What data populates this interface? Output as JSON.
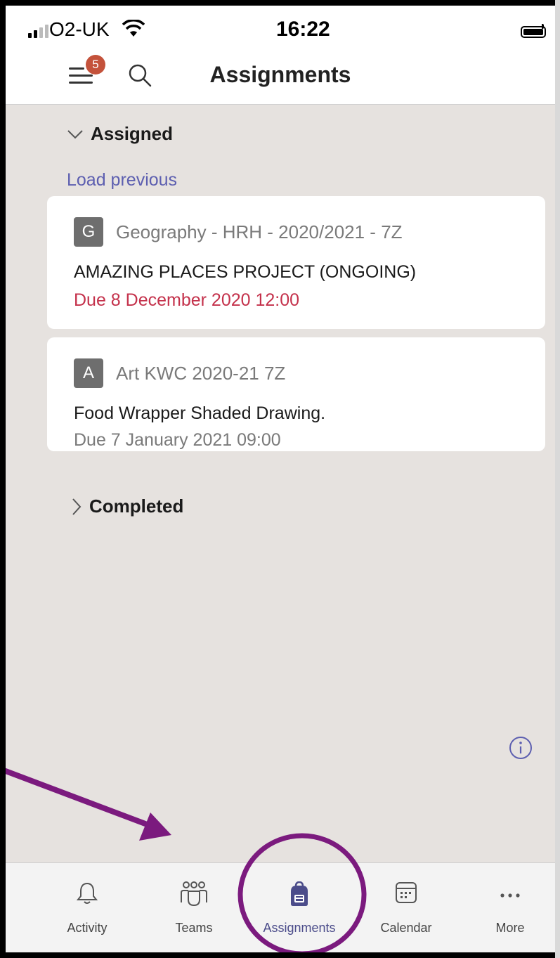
{
  "status_bar": {
    "carrier": "O2-UK",
    "time": "16:22"
  },
  "header": {
    "title": "Assignments",
    "notification_count": "5"
  },
  "assigned_section": {
    "label": "Assigned",
    "load_previous": "Load previous"
  },
  "assignments": [
    {
      "letter": "G",
      "course": "Geography - HRH - 2020/2021 - 7Z",
      "title": "AMAZING PLACES PROJECT (ONGOING)",
      "due": "Due 8 December 2020 12:00",
      "due_color": "#c4314b"
    },
    {
      "letter": "A",
      "course": "Art KWC 2020-21 7Z",
      "title": "Food Wrapper Shaded Drawing.",
      "due": "Due 7 January 2021 09:00",
      "due_color": "#7a7a7a"
    }
  ],
  "completed_section": {
    "label": "Completed"
  },
  "tabs": [
    {
      "label": "Activity",
      "icon": "bell-icon"
    },
    {
      "label": "Teams",
      "icon": "teams-icon"
    },
    {
      "label": "Assignments",
      "icon": "backpack-icon",
      "active": true
    },
    {
      "label": "Calendar",
      "icon": "calendar-icon"
    },
    {
      "label": "More",
      "icon": "more-icon"
    }
  ],
  "colors": {
    "accent": "#5d5fb0",
    "annotation": "#7b1a7e",
    "overdue": "#c4314b",
    "background": "#e6e2df"
  }
}
